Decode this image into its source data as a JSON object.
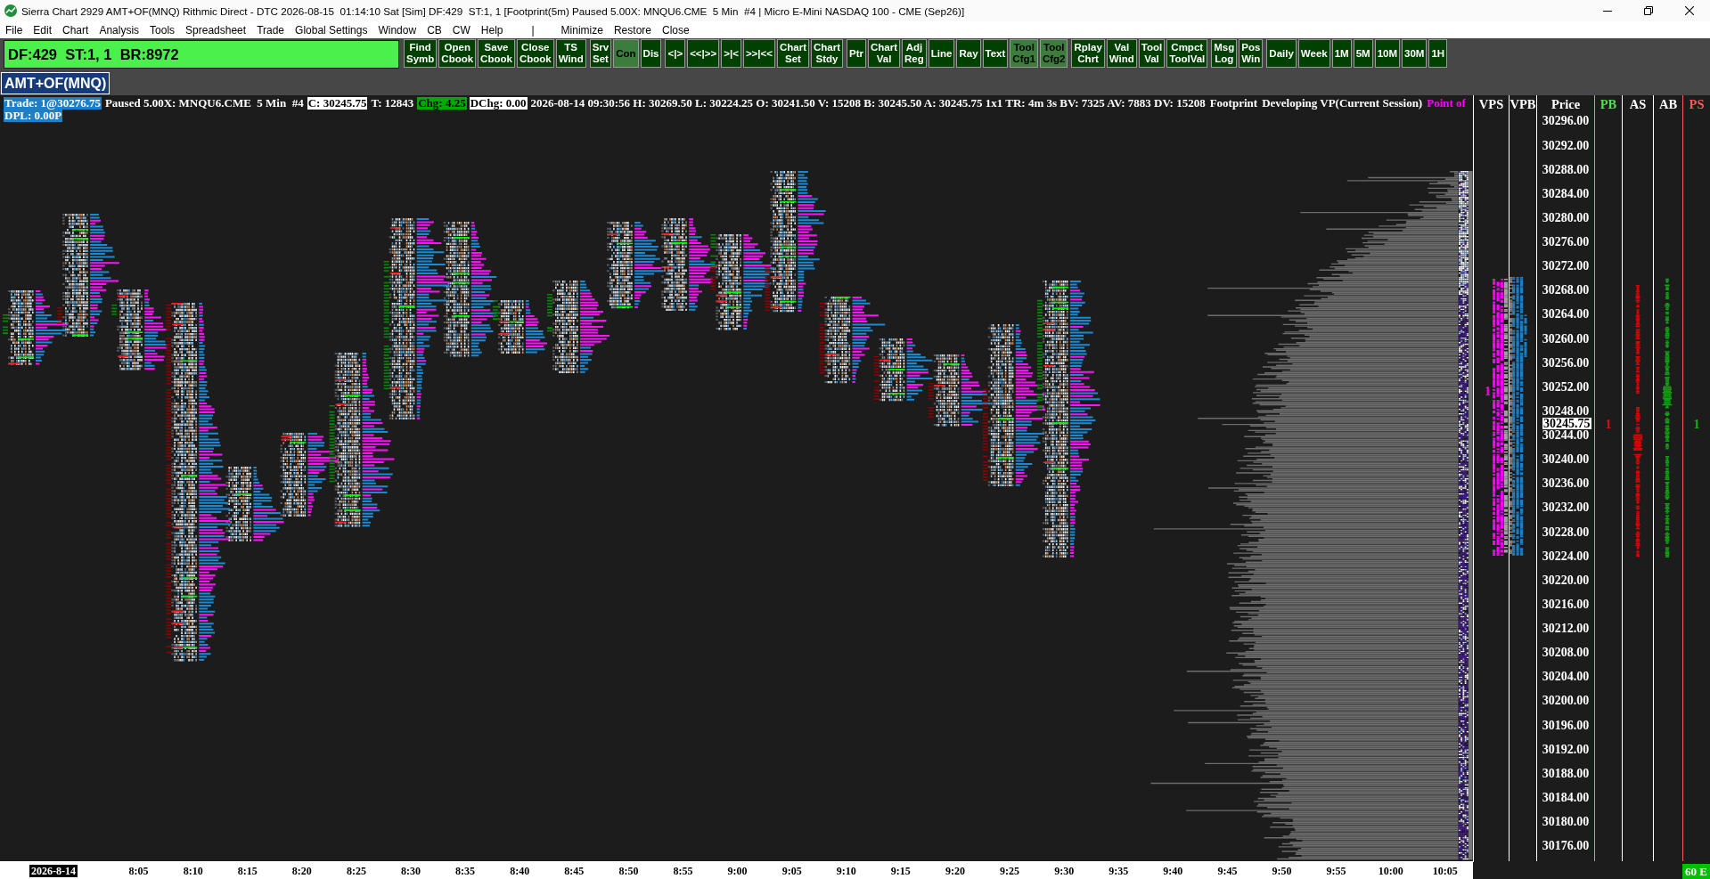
{
  "window": {
    "title": "Sierra Chart 2929 AMT+OF(MNQ) Rithmic Direct - DTC 2026-08-15  01:14:10 Sat [Sim] DF:429  ST:1, 1 [Footprint(5m) Paused 5.00X: MNQU6.CME  5 Min  #4 | Micro E-Mini NASDAQ 100 - CME (Sep26)]"
  },
  "menu": [
    {
      "label": "File",
      "kind": "item"
    },
    {
      "label": "Edit",
      "kind": "item"
    },
    {
      "label": "Chart",
      "kind": "item"
    },
    {
      "label": "Analysis",
      "kind": "item"
    },
    {
      "label": "Tools",
      "kind": "item"
    },
    {
      "label": "Spreadsheet",
      "kind": "item"
    },
    {
      "label": "Trade",
      "kind": "item"
    },
    {
      "label": "Global Settings",
      "kind": "item"
    },
    {
      "label": "Window",
      "kind": "item"
    },
    {
      "label": "CB",
      "kind": "item"
    },
    {
      "label": "CW",
      "kind": "item"
    },
    {
      "label": "Help",
      "kind": "item"
    },
    {
      "label": "|",
      "kind": "separator"
    },
    {
      "label": "Minimize",
      "kind": "item"
    },
    {
      "label": "Restore",
      "kind": "item"
    },
    {
      "label": "Close",
      "kind": "item"
    }
  ],
  "toolbar": {
    "status": "DF:429  ST:1, 1  BR:8972",
    "groups": [
      {
        "buttons": [
          {
            "label": "Find Symb",
            "disabled": false
          },
          {
            "label": "Open Cbook",
            "disabled": false
          },
          {
            "label": "Save Cbook",
            "disabled": false
          },
          {
            "label": "Close Cbook",
            "disabled": false
          },
          {
            "label": "TS Wind",
            "disabled": false
          }
        ]
      },
      {
        "buttons": [
          {
            "label": "Srv Set",
            "disabled": false
          },
          {
            "label": "Con",
            "disabled": true
          },
          {
            "label": "Dis",
            "disabled": false
          }
        ]
      },
      {
        "buttons": [
          {
            "label": "<|>",
            "disabled": false
          },
          {
            "label": "<<|>>",
            "disabled": false
          },
          {
            "label": ">|<",
            "disabled": false
          },
          {
            "label": ">>|<<",
            "disabled": false
          },
          {
            "label": "Chart Set",
            "disabled": false
          },
          {
            "label": "Chart Stdy",
            "disabled": false
          }
        ]
      },
      {
        "buttons": [
          {
            "label": "Ptr",
            "disabled": false
          },
          {
            "label": "Chart Val",
            "disabled": false
          },
          {
            "label": "Adj Reg",
            "disabled": false
          },
          {
            "label": "Line",
            "disabled": false
          },
          {
            "label": "Ray",
            "disabled": false
          },
          {
            "label": "Text",
            "disabled": false
          },
          {
            "label": "Tool Cfg1",
            "disabled": true
          },
          {
            "label": "Tool Cfg2",
            "disabled": true
          }
        ]
      },
      {
        "buttons": [
          {
            "label": "Rplay Chrt",
            "disabled": false
          },
          {
            "label": "Val Wind",
            "disabled": false
          },
          {
            "label": "Tool Val",
            "disabled": false
          },
          {
            "label": "Cmpct ToolVal",
            "disabled": false
          }
        ]
      },
      {
        "buttons": [
          {
            "label": "Msg Log",
            "disabled": false
          },
          {
            "label": "Pos Win",
            "disabled": false
          }
        ]
      },
      {
        "buttons": [
          {
            "label": "Daily",
            "disabled": false
          },
          {
            "label": "Week",
            "disabled": false
          },
          {
            "label": "1M",
            "disabled": false
          },
          {
            "label": "5M",
            "disabled": false
          },
          {
            "label": "10M",
            "disabled": false
          },
          {
            "label": "30M",
            "disabled": false
          },
          {
            "label": "1H",
            "disabled": false
          }
        ]
      }
    ]
  },
  "chart": {
    "tab": {
      "label": "AMT+OF(MNQ)",
      "selected": true
    },
    "info": [
      {
        "text": "Trade: 1@30276.75",
        "kind": "trade"
      },
      {
        "text": "Paused 5.00X: MNQU6.CME  5 Min  #4",
        "kind": "plain"
      },
      {
        "text": "C: 30245.75",
        "kind": "boxed"
      },
      {
        "text": "T: 12843",
        "kind": "plain"
      },
      {
        "text": "Chg: 4.25",
        "kind": "up"
      },
      {
        "text": "DChg: 0.00",
        "kind": "boxed"
      },
      {
        "text": "2026-08-14 09:30:56 H: 30269.50 L: 30224.25 O: 30241.50 V: 15208 B: 30245.50 A: 30245.75 1x1 TR: 4m 3s BV: 7325 AV: 7883 DV: 15208",
        "kind": "plain"
      },
      {
        "text": "Footprint",
        "kind": "plain"
      },
      {
        "text": "Developing VP(Current Session)",
        "kind": "plain"
      },
      {
        "text": "Point of",
        "kind": "study"
      }
    ],
    "info_line_2": [
      {
        "text": "DPL: 0.00P",
        "kind": "trade"
      }
    ]
  },
  "price_scale": {
    "columns": [
      {
        "label": "VPS",
        "color": "#ffffff",
        "value": {
          "text": "1",
          "color": "#ff00ff"
        }
      },
      {
        "label": "VPB",
        "color": "#ffffff"
      },
      {
        "label": "Price",
        "color": "#ffffff"
      },
      {
        "label": "PB",
        "color": "#55dd55",
        "value": {
          "text": "1",
          "color": "#e01010"
        }
      },
      {
        "label": "AS",
        "color": "#ffffff"
      },
      {
        "label": "AB",
        "color": "#ffffff"
      },
      {
        "label": "PS",
        "color": "#ff5a5a",
        "value": {
          "text": "1",
          "color": "#10b010"
        }
      }
    ],
    "prices": [
      "30296.00",
      "30292.00",
      "30288.00",
      "30284.00",
      "30280.00",
      "30276.00",
      "30272.00",
      "30268.00",
      "30264.00",
      "30260.00",
      "30256.00",
      "30252.00",
      "30248.00",
      "30244.00",
      "30240.00",
      "30236.00",
      "30232.00",
      "30228.00",
      "30224.00",
      "30220.00",
      "30216.00",
      "30212.00",
      "30208.00",
      "30204.00",
      "30200.00",
      "30196.00",
      "30192.00",
      "30188.00",
      "30184.00",
      "30180.00",
      "30176.00"
    ],
    "last_price": "30245.75"
  },
  "time_axis": {
    "date": "2026-8-14",
    "labels": [
      "8:05",
      "8:10",
      "8:15",
      "8:20",
      "8:25",
      "8:30",
      "8:35",
      "8:40",
      "8:45",
      "8:50",
      "8:55",
      "9:00",
      "9:05",
      "9:10",
      "9:15",
      "9:20",
      "9:25",
      "9:30",
      "9:35",
      "9:40",
      "9:45",
      "9:50",
      "9:55",
      "10:00",
      "10:05"
    ]
  },
  "status_badge": "60 E"
}
